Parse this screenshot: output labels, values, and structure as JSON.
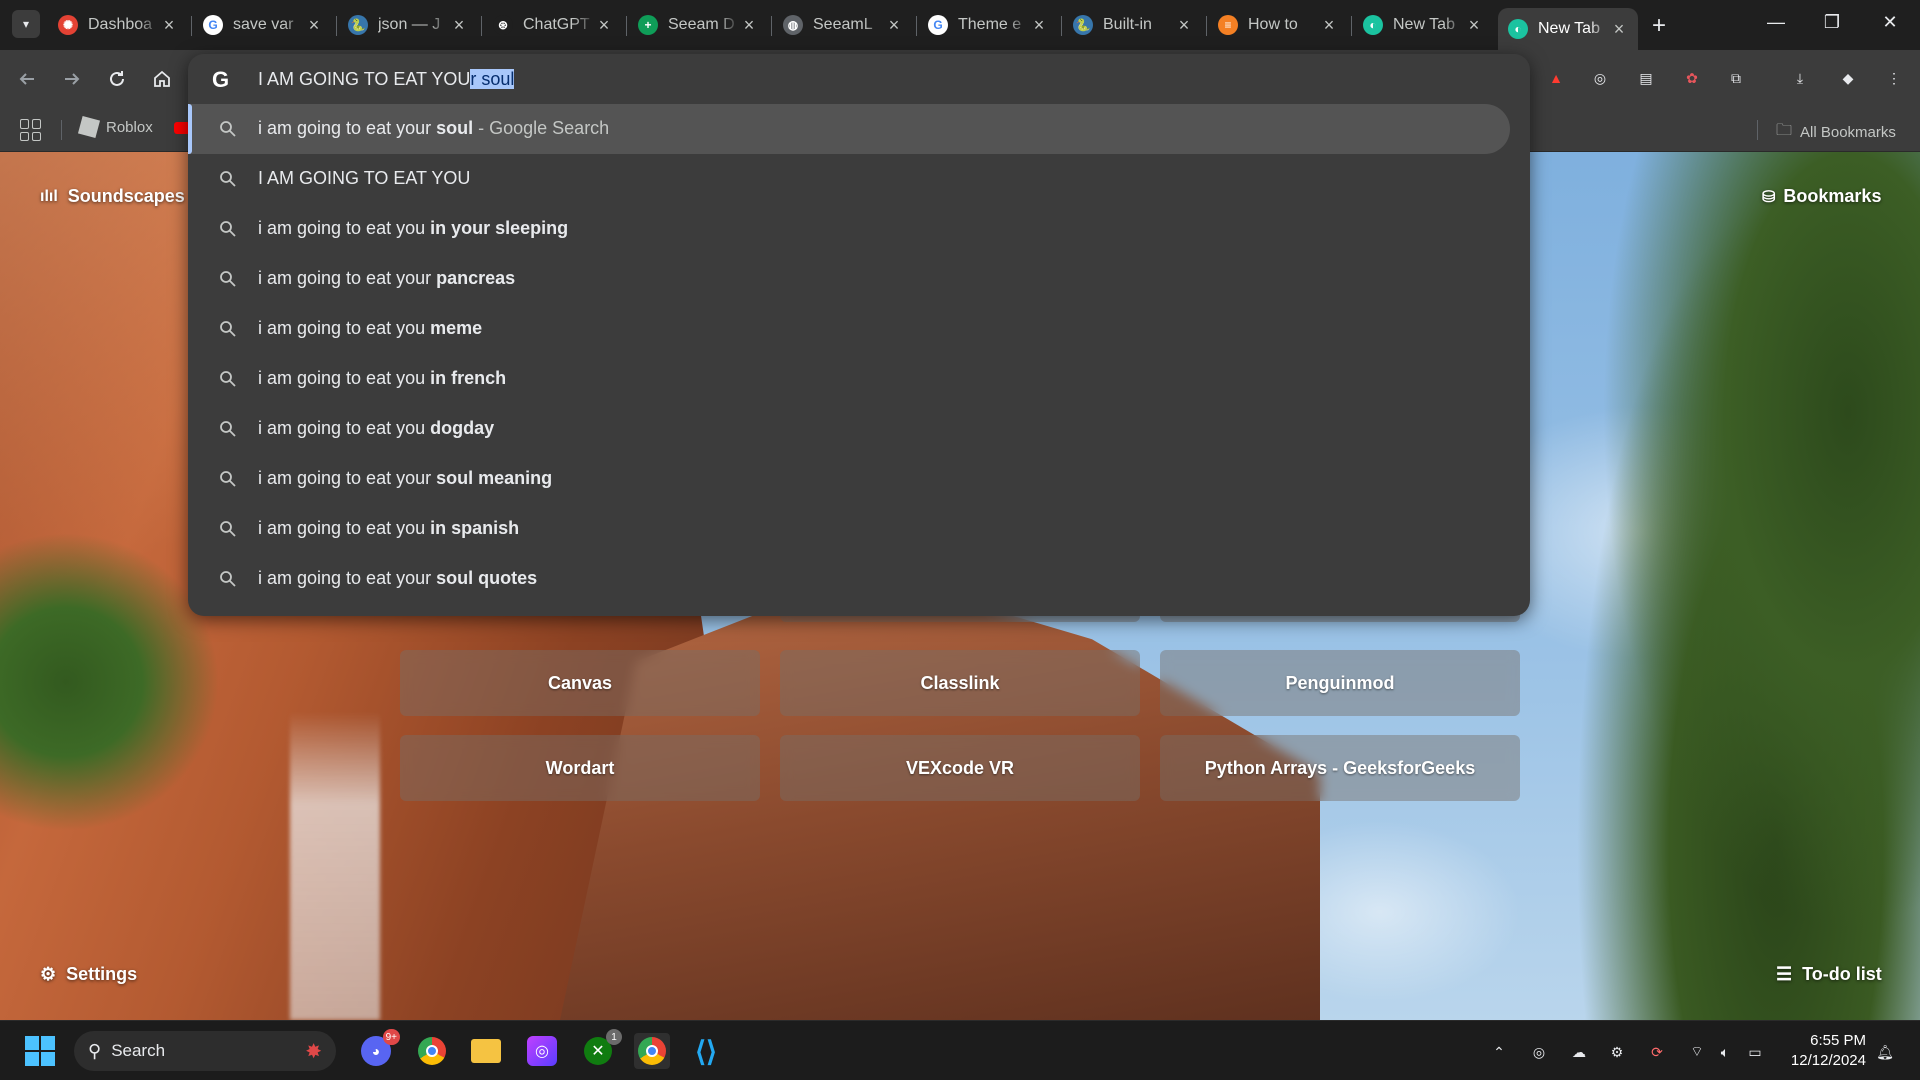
{
  "browser": {
    "tabs": [
      {
        "title": "Dashboa",
        "favicon": "canvas-icon",
        "color": "#e34234",
        "glyph": "✺",
        "active": false
      },
      {
        "title": "save var",
        "favicon": "google-icon",
        "color": "#ffffff",
        "glyph": "G",
        "active": false
      },
      {
        "title": "json — J",
        "favicon": "python-icon",
        "color": "#3776ab",
        "glyph": "🐍",
        "active": false
      },
      {
        "title": "ChatGPT",
        "favicon": "chatgpt-icon",
        "color": "#1f1f1f",
        "glyph": "⊛",
        "active": false
      },
      {
        "title": "Seeam D",
        "favicon": "sheets-icon",
        "color": "#0f9d58",
        "glyph": "+",
        "active": false
      },
      {
        "title": "SeeamL",
        "favicon": "globe-icon",
        "color": "#5f6368",
        "glyph": "◍",
        "active": false
      },
      {
        "title": "Theme e",
        "favicon": "google-icon",
        "color": "#ffffff",
        "glyph": "G",
        "active": false
      },
      {
        "title": "Built-in",
        "favicon": "python-icon",
        "color": "#3776ab",
        "glyph": "🐍",
        "active": false
      },
      {
        "title": "How to",
        "favicon": "stackoverflow-icon",
        "color": "#f48024",
        "glyph": "≡",
        "active": false
      },
      {
        "title": "New Tab",
        "favicon": "bonjourr-icon",
        "color": "#1bc3a0",
        "glyph": "◐",
        "active": false
      },
      {
        "title": "New Tab",
        "favicon": "bonjourr-icon",
        "color": "#1bc3a0",
        "glyph": "◐",
        "active": true
      }
    ],
    "bookmarks": {
      "roblox_label": "Roblox",
      "all_bookmarks_label": "All Bookmarks"
    }
  },
  "omnibox": {
    "typed_text": "I AM GOING TO EAT YOU",
    "autocomplete_text": "r soul",
    "suggestions": [
      {
        "parts": [
          {
            "t": "i am going to eat your ",
            "b": false
          },
          {
            "t": "soul",
            "b": true
          },
          {
            "t": " - Google Search",
            "b": false,
            "dim": true
          }
        ],
        "highlighted": true
      },
      {
        "parts": [
          {
            "t": "I AM GOING TO EAT YOU",
            "b": false
          }
        ]
      },
      {
        "parts": [
          {
            "t": "i am going to eat you ",
            "b": false
          },
          {
            "t": "in your sleeping",
            "b": true
          }
        ]
      },
      {
        "parts": [
          {
            "t": "i am going to eat your ",
            "b": false
          },
          {
            "t": "pancreas",
            "b": true
          }
        ]
      },
      {
        "parts": [
          {
            "t": "i am going to eat you ",
            "b": false
          },
          {
            "t": "meme",
            "b": true
          }
        ]
      },
      {
        "parts": [
          {
            "t": "i am going to eat you ",
            "b": false
          },
          {
            "t": "in french",
            "b": true
          }
        ]
      },
      {
        "parts": [
          {
            "t": "i am going to eat you ",
            "b": false
          },
          {
            "t": "dogday",
            "b": true
          }
        ]
      },
      {
        "parts": [
          {
            "t": "i am going to eat your ",
            "b": false
          },
          {
            "t": "soul meaning",
            "b": true
          }
        ]
      },
      {
        "parts": [
          {
            "t": "i am going to eat you ",
            "b": false
          },
          {
            "t": "in spanish",
            "b": true
          }
        ]
      },
      {
        "parts": [
          {
            "t": "i am going to eat your ",
            "b": false
          },
          {
            "t": "soul quotes",
            "b": true
          }
        ]
      }
    ]
  },
  "newtab": {
    "soundscapes_label": "Soundscapes",
    "bookmarks_label": "Bookmarks",
    "settings_label": "Settings",
    "todo_label": "To-do list",
    "shortcuts": [
      "Canvas",
      "Classlink",
      "Penguinmod",
      "Wordart",
      "VEXcode VR",
      "Python Arrays - GeeksforGeeks"
    ]
  },
  "taskbar": {
    "search_label": "Search",
    "discord_badge": "9+",
    "xbox_badge": "1",
    "time": "6:55 PM",
    "date": "12/12/2024"
  },
  "colors": {
    "accent": "#a8c7fa",
    "omnibox_bg": "#3c3c3c",
    "highlight_bg": "#545454"
  }
}
